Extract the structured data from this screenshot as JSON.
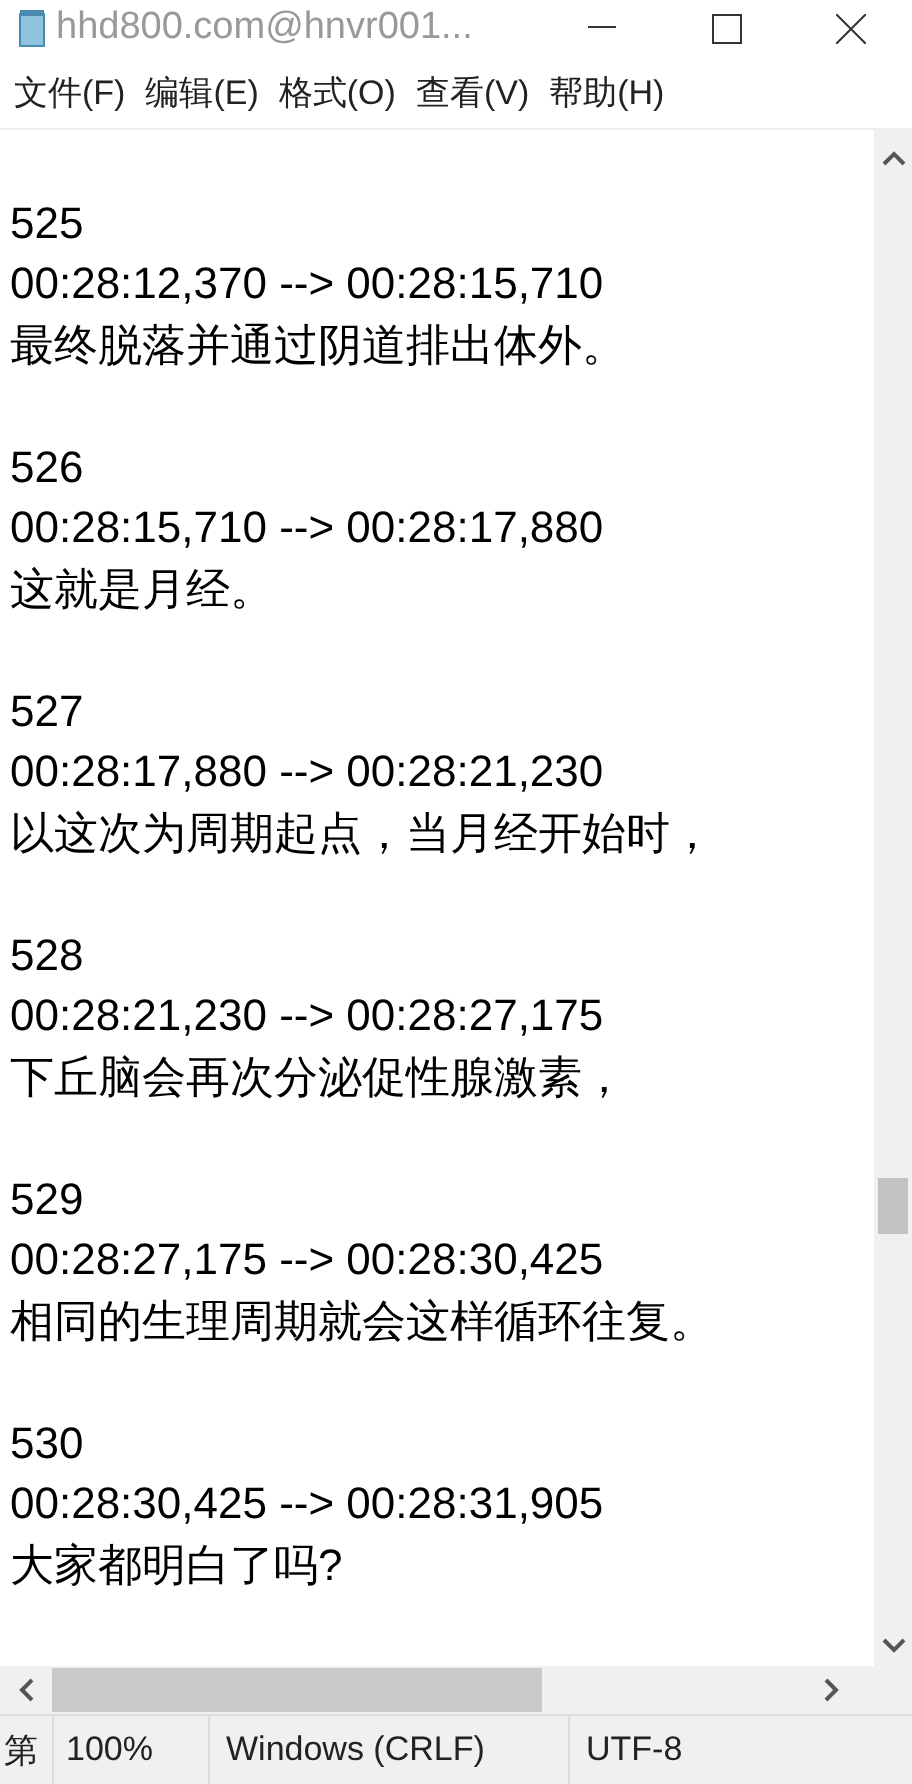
{
  "window": {
    "title": "hhd800.com@hnvr001..."
  },
  "menu": [
    "文件(F)",
    "编辑(E)",
    "格式(O)",
    "查看(V)",
    "帮助(H)"
  ],
  "entries": [
    {
      "index": "525",
      "timing": "00:28:12,370 --> 00:28:15,710",
      "text": "最终脱落并通过阴道排出体外。"
    },
    {
      "index": "526",
      "timing": "00:28:15,710 --> 00:28:17,880",
      "text": "这就是月经。"
    },
    {
      "index": "527",
      "timing": "00:28:17,880 --> 00:28:21,230",
      "text": "以这次为周期起点，当月经开始时，"
    },
    {
      "index": "528",
      "timing": "00:28:21,230 --> 00:28:27,175",
      "text": "下丘脑会再次分泌促性腺激素，"
    },
    {
      "index": "529",
      "timing": "00:28:27,175 --> 00:28:30,425",
      "text": "相同的生理周期就会这样循环往复。"
    },
    {
      "index": "530",
      "timing": "00:28:30,425 --> 00:28:31,905",
      "text": "大家都明白了吗?"
    }
  ],
  "status_bar": [
    "第",
    "100%",
    "Windows (CRLF)",
    "UTF-8"
  ]
}
